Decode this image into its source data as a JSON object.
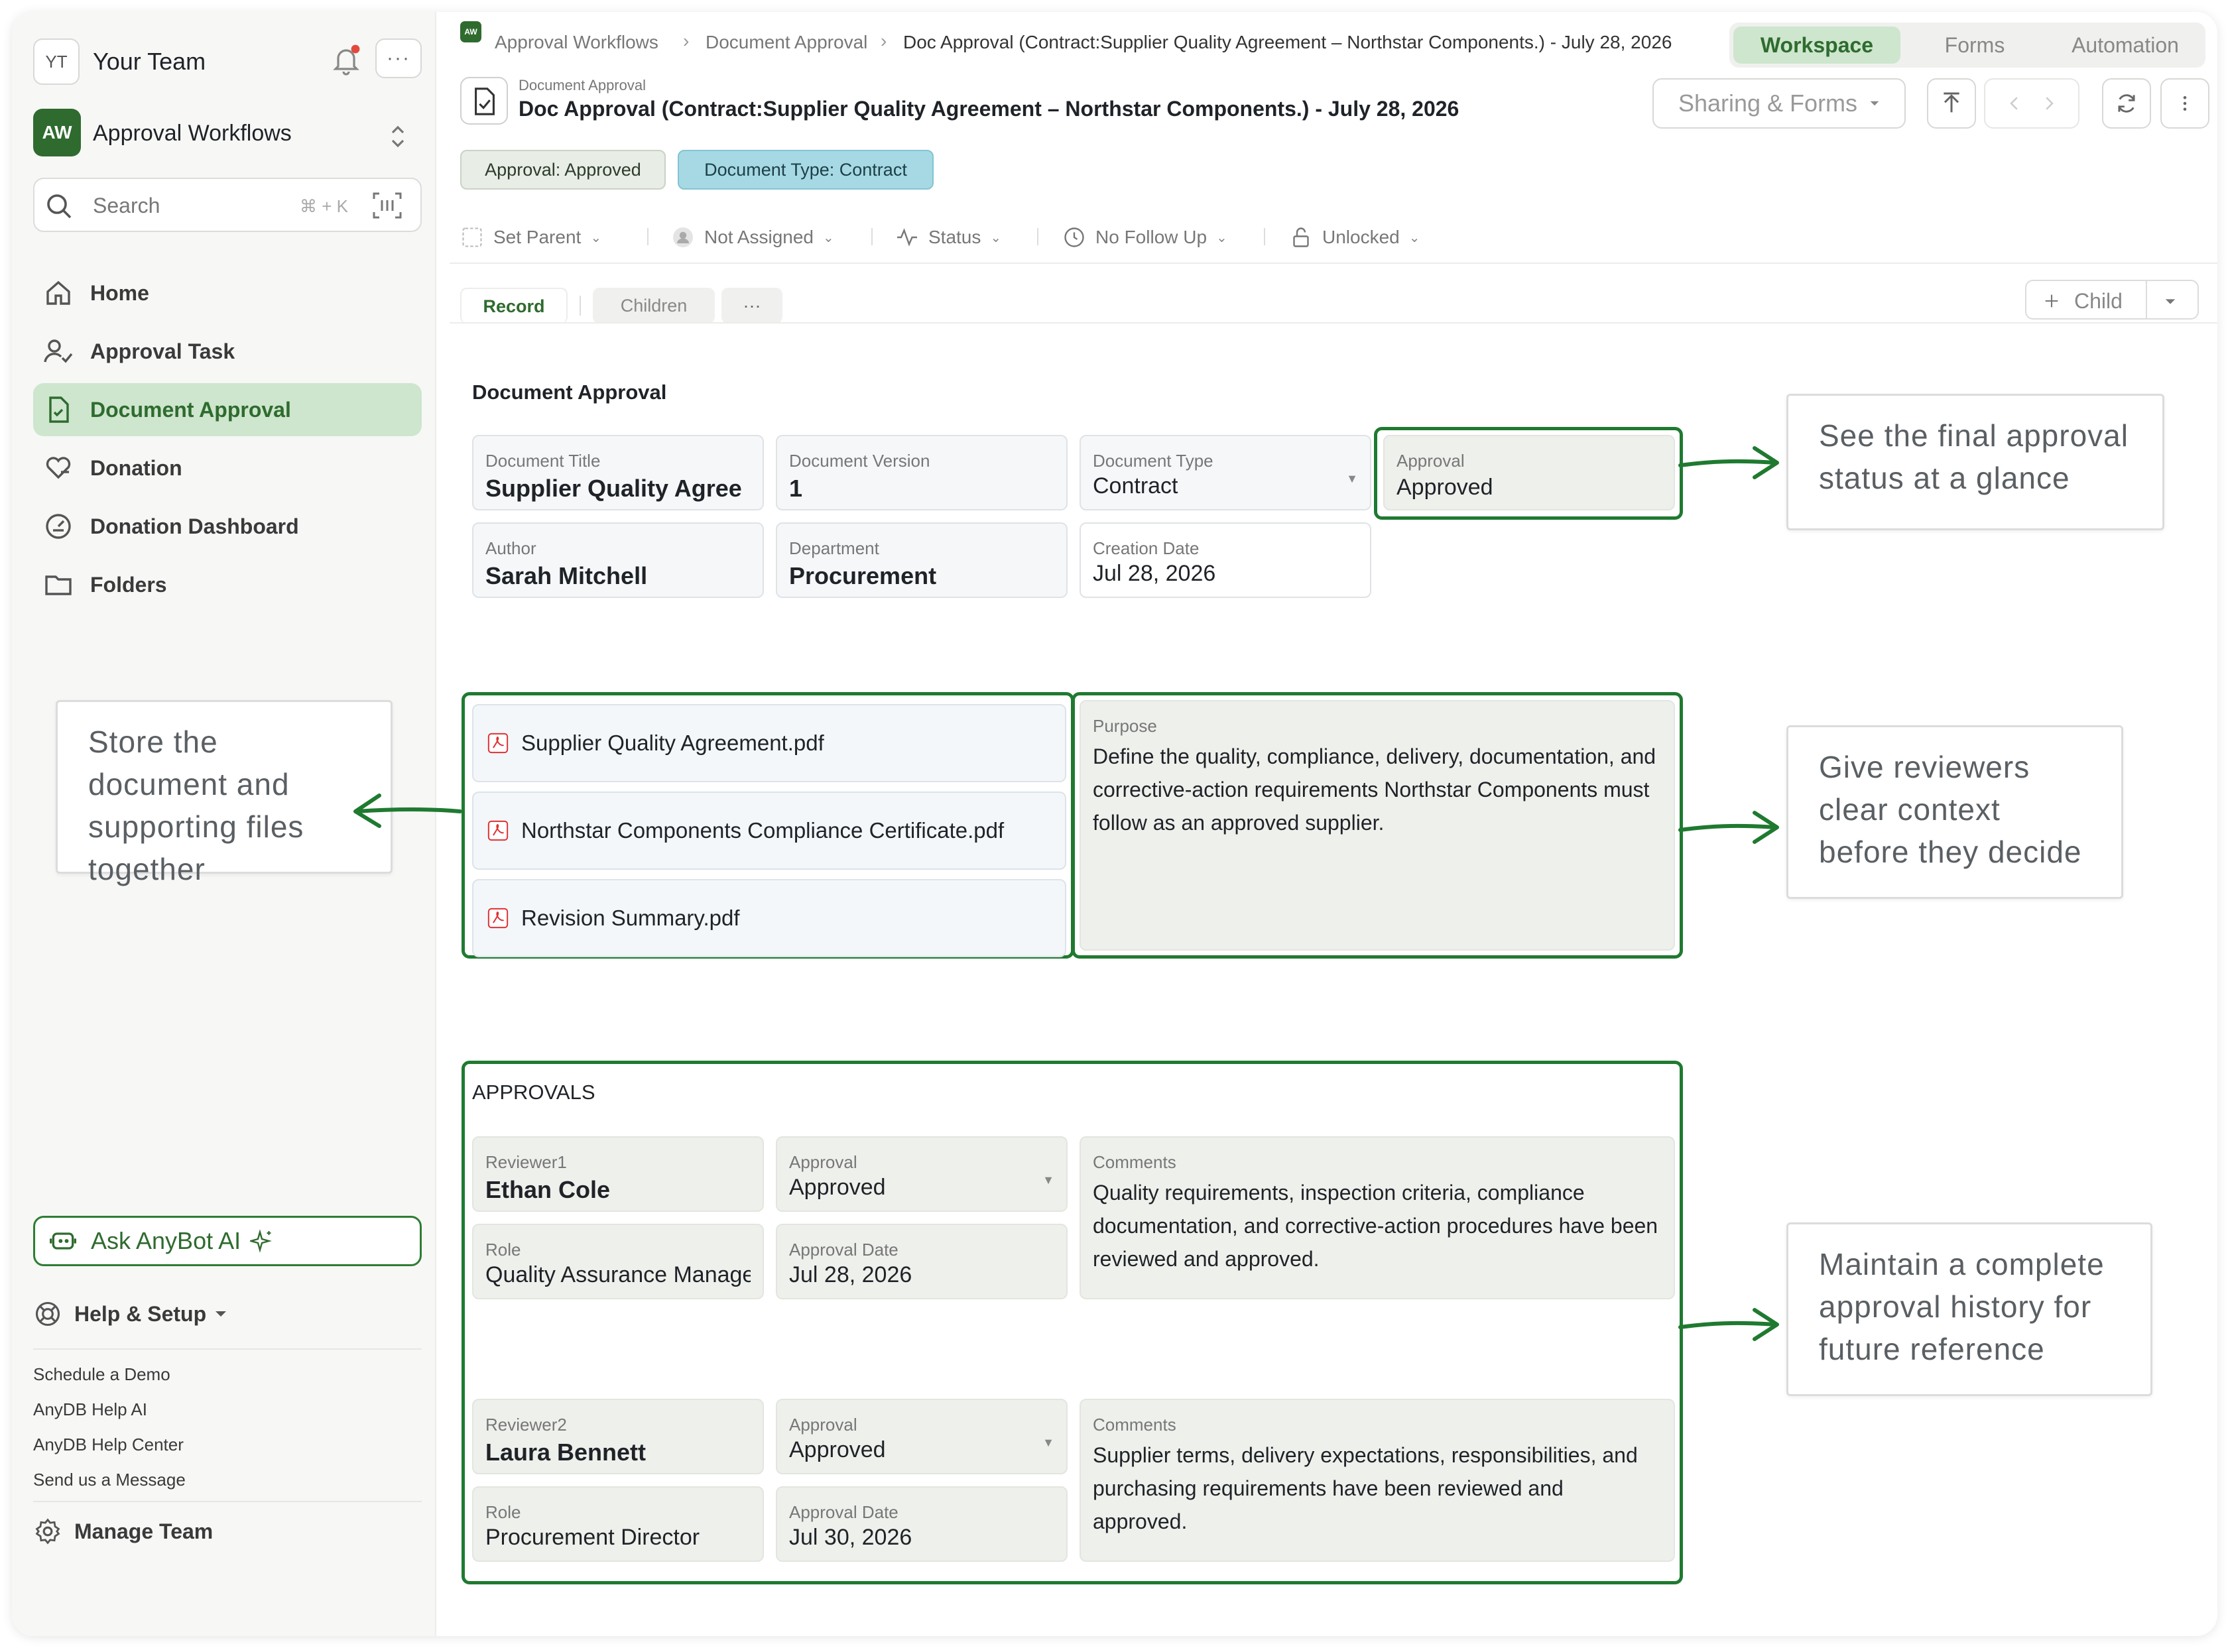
{
  "sidebar": {
    "team_badge": "YT",
    "team_name": "Your Team",
    "more_dots": "···",
    "workspace_badge": "AW",
    "workspace_name": "Approval Workflows",
    "search_label": "Search",
    "search_shortcut": "⌘ + K",
    "nav": [
      {
        "label": "Home",
        "icon": "home-icon"
      },
      {
        "label": "Approval Task",
        "icon": "user-check-icon"
      },
      {
        "label": "Document Approval",
        "icon": "document-icon",
        "active": true
      },
      {
        "label": "Donation",
        "icon": "heart-hand-icon"
      },
      {
        "label": "Donation Dashboard",
        "icon": "gauge-icon"
      },
      {
        "label": "Folders",
        "icon": "folder-icon"
      }
    ],
    "ask_label": "Ask AnyBot AI",
    "help_label": "Help & Setup",
    "links": [
      "Schedule a Demo",
      "AnyDB Help AI",
      "AnyDB Help Center",
      "Send us a Message"
    ],
    "manage_label": "Manage Team"
  },
  "header": {
    "crumb_badge": "AW",
    "breadcrumbs": [
      "Approval Workflows",
      "Document Approval",
      "Doc Approval (Contract:Supplier Quality Agreement – Northstar Components.) - July 28, 2026"
    ],
    "view_tabs": [
      "Workspace",
      "Forms",
      "Automation"
    ],
    "active_view": "Workspace",
    "small_title": "Document Approval",
    "title": "Doc Approval (Contract:Supplier Quality Agreement – Northstar Components.) - July 28, 2026",
    "share_label": "Sharing & Forms",
    "pills": [
      "Approval: Approved",
      "Document Type: Contract"
    ],
    "meta": [
      "Set Parent",
      "Not Assigned",
      "Status",
      "No Follow Up",
      "Unlocked"
    ]
  },
  "tabs": {
    "items": [
      "Record",
      "Children",
      "···"
    ],
    "active": "Record",
    "child_label": "Child"
  },
  "record": {
    "section_title": "Document Approval",
    "fields": {
      "doc_title": {
        "label": "Document Title",
        "value": "Supplier Quality Agree"
      },
      "doc_version": {
        "label": "Document Version",
        "value": "1"
      },
      "doc_type": {
        "label": "Document Type",
        "value": "Contract"
      },
      "approval": {
        "label": "Approval",
        "value": "Approved"
      },
      "author": {
        "label": "Author",
        "value": "Sarah Mitchell"
      },
      "department": {
        "label": "Department",
        "value": "Procurement"
      },
      "creation_date": {
        "label": "Creation Date",
        "value": "Jul 28, 2026"
      }
    },
    "files": [
      "Supplier Quality Agreement.pdf",
      "Northstar Components Compliance Certificate.pdf",
      "Revision Summary.pdf"
    ],
    "purpose": {
      "label": "Purpose",
      "value": "Define the quality, compliance, delivery, documentation, and corrective-action requirements Northstar Components must follow as an approved supplier."
    },
    "approvals_title": "APPROVALS",
    "reviewers": [
      {
        "reviewer_label": "Reviewer1",
        "reviewer": "Ethan Cole",
        "approval_label": "Approval",
        "approval": "Approved",
        "role_label": "Role",
        "role": "Quality Assurance Manage",
        "date_label": "Approval Date",
        "date": "Jul 28, 2026",
        "comments_label": "Comments",
        "comments": "Quality requirements, inspection criteria, compliance documentation, and corrective-action procedures have been reviewed and approved."
      },
      {
        "reviewer_label": "Reviewer2",
        "reviewer": "Laura Bennett",
        "approval_label": "Approval",
        "approval": "Approved",
        "role_label": "Role",
        "role": "Procurement Director",
        "date_label": "Approval Date",
        "date": "Jul 30, 2026",
        "comments_label": "Comments",
        "comments": "Supplier terms, delivery expectations, responsibilities, and purchasing requirements have been reviewed and approved."
      }
    ]
  },
  "callouts": {
    "status": "See the final approval status at a glance",
    "files": "Store the document and supporting files together",
    "context": "Give reviewers clear context before they decide",
    "history": "Maintain a complete approval history for future reference"
  },
  "colors": {
    "accent_green": "#1f7a30",
    "active_nav_bg": "#cde6cd",
    "type_pill": "#a6d9e4"
  }
}
